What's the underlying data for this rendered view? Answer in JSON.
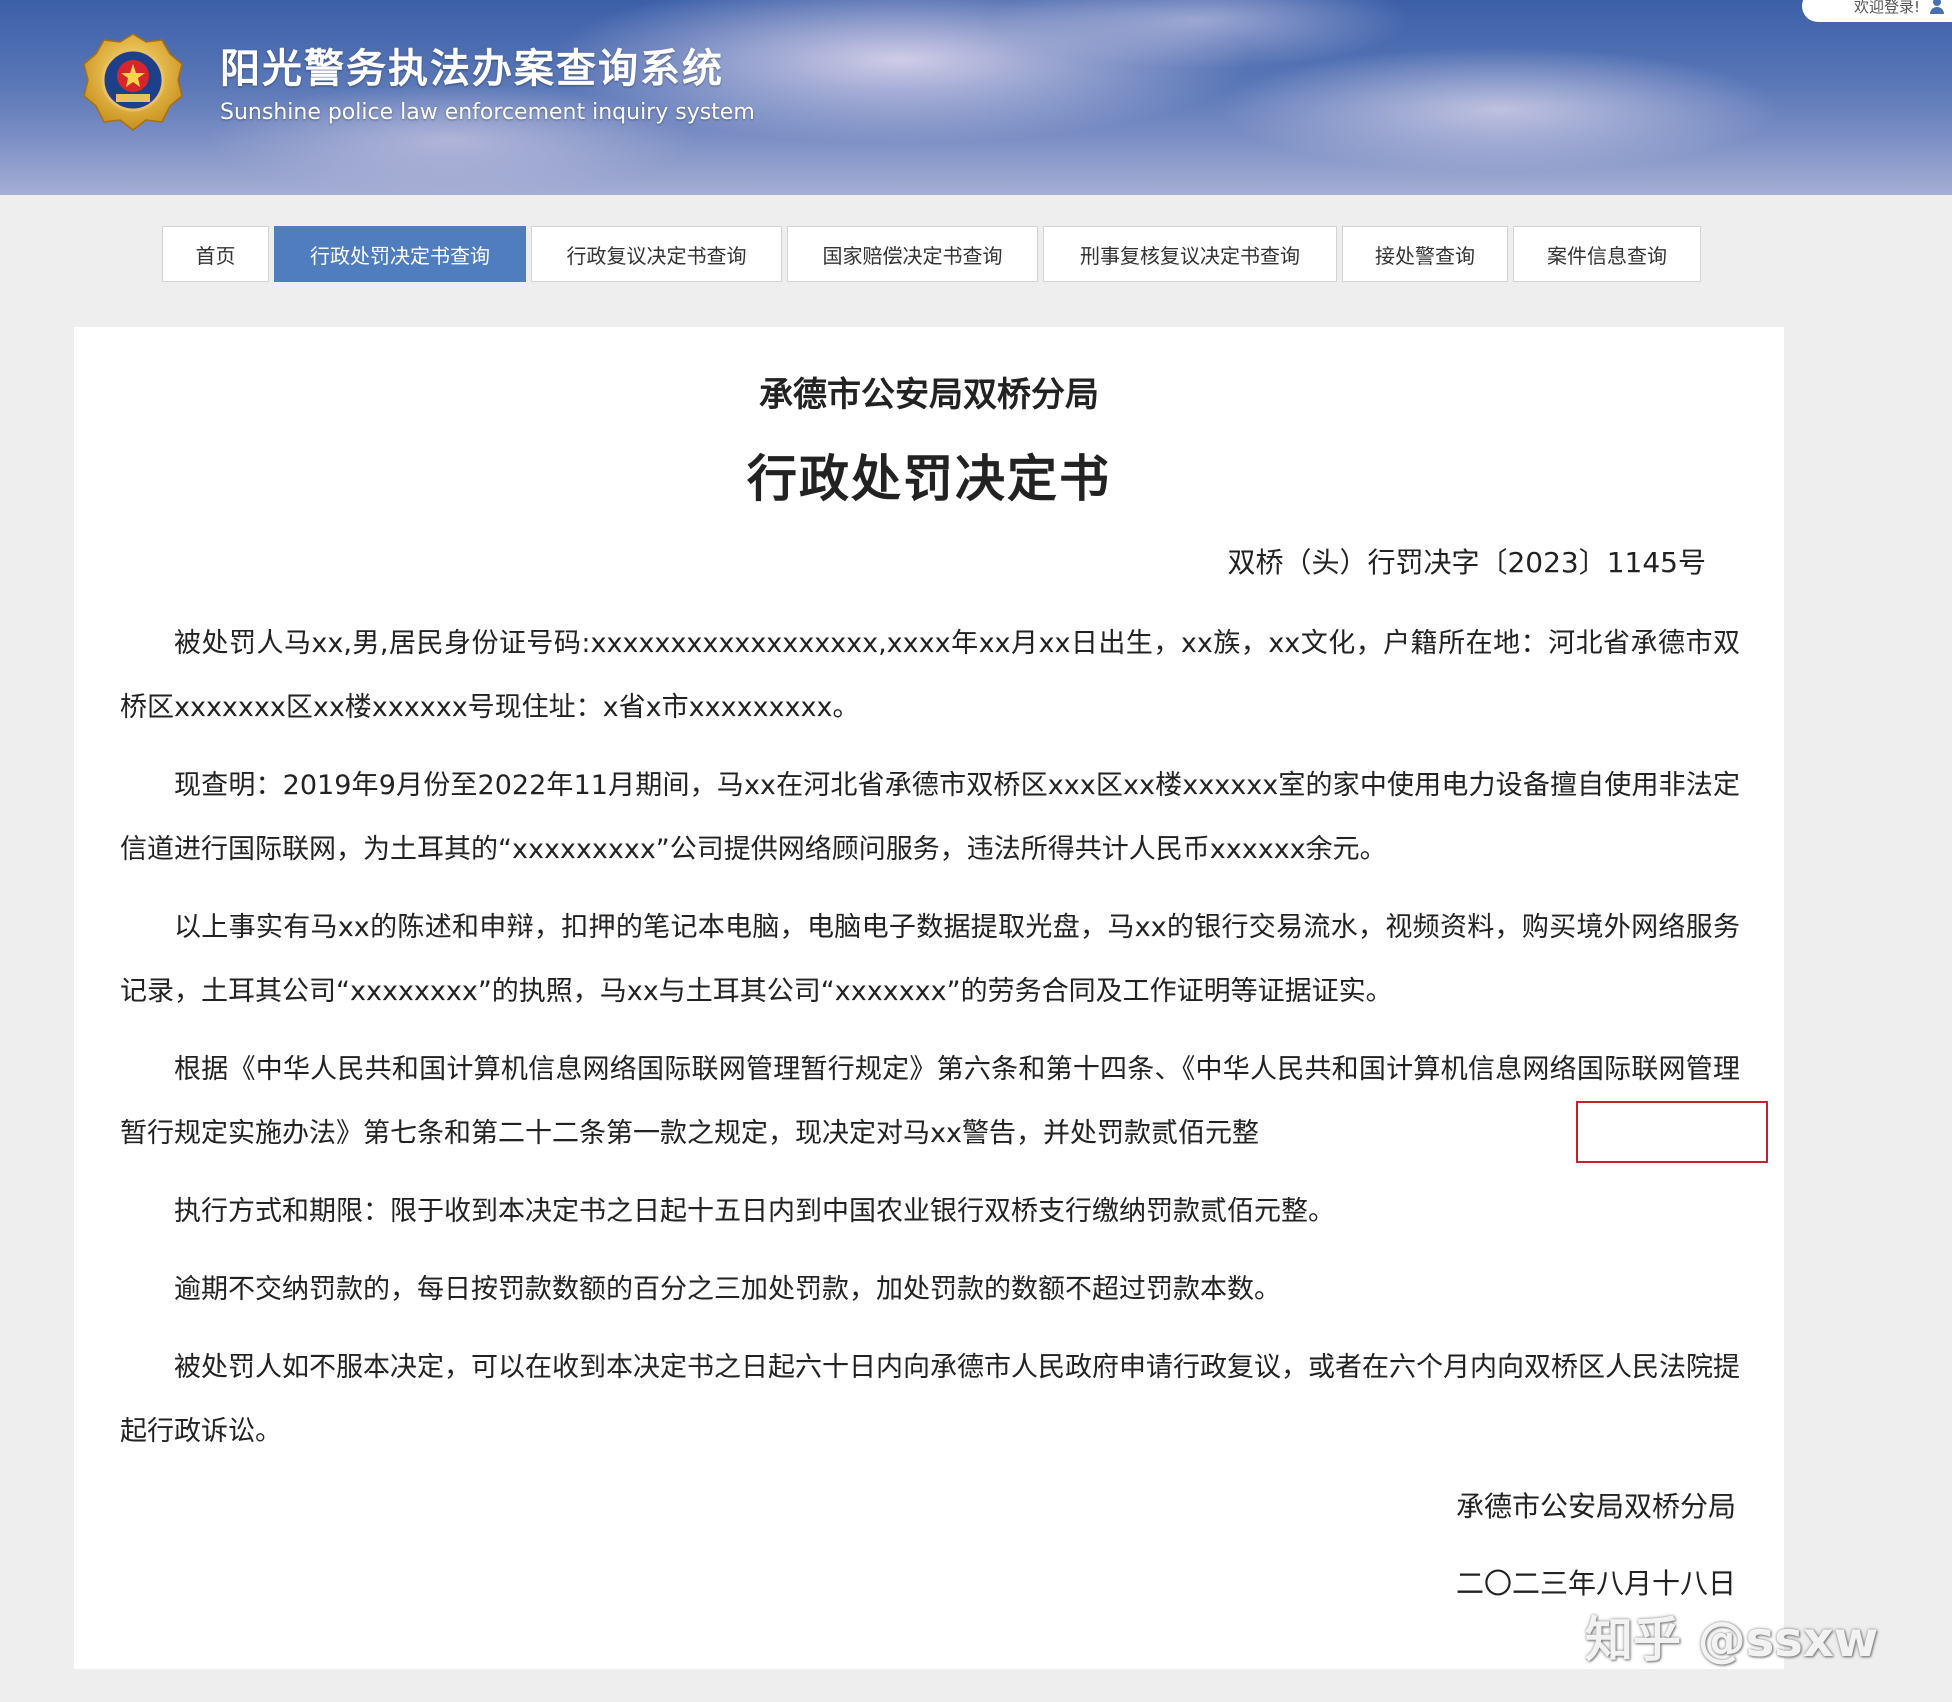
{
  "header": {
    "title": "阳光警务执法办案查询系统",
    "subtitle": "Sunshine police law enforcement inquiry system",
    "login_text": "欢迎登录!",
    "emblem_icon": "police-emblem-icon",
    "user_icon": "user-icon"
  },
  "nav": {
    "tabs": [
      {
        "label": "首页"
      },
      {
        "label": "行政处罚决定书查询"
      },
      {
        "label": "行政复议决定书查询"
      },
      {
        "label": "国家赔偿决定书查询"
      },
      {
        "label": "刑事复核复议决定书查询"
      },
      {
        "label": "接处警查询"
      },
      {
        "label": "案件信息查询"
      }
    ],
    "active_index": 1
  },
  "document": {
    "org": "承德市公安局双桥分局",
    "title": "行政处罚决定书",
    "number": "双桥（头）行罚决字〔2023〕1145号",
    "paragraphs": [
      "被处罚人马xx,男,居民身份证号码:xxxxxxxxxxxxxxxxxx,xxxx年xx月xx日出生，xx族，xx文化，户籍所在地：河北省承德市双桥区xxxxxxx区xx楼xxxxxx号现住址：x省x市xxxxxxxxx。",
      "现查明：2019年9月份至2022年11月期间，马xx在河北省承德市双桥区xxx区xx楼xxxxxx室的家中使用电力设备擅自使用非法定信道进行国际联网，为土耳其的“xxxxxxxxx”公司提供网络顾问服务，违法所得共计人民币xxxxxx余元。",
      "以上事实有马xx的陈述和申辩，扣押的笔记本电脑，电脑电子数据提取光盘，马xx的银行交易流水，视频资料，购买境外网络服务记录，土耳其公司“xxxxxxxx”的执照，马xx与土耳其公司“xxxxxxx”的劳务合同及工作证明等证据证实。",
      "根据《中华人民共和国计算机信息网络国际联网管理暂行规定》第六条和第十四条、《中华人民共和国计算机信息网络国际联网管理暂行规定实施办法》第七条和第二十二条第一款之规定，现决定对马xx警告，并处罚款贰佰元整",
      "执行方式和期限：限于收到本决定书之日起十五日内到中国农业银行双桥支行缴纳罚款贰佰元整。",
      "逾期不交纳罚款的，每日按罚款数额的百分之三加处罚款，加处罚款的数额不超过罚款本数。",
      "被处罚人如不服本决定，可以在收到本决定书之日起六十日内向承德市人民政府申请行政复议，或者在六个月内向双桥区人民法院提起行政诉讼。"
    ],
    "sign_org": "承德市公安局双桥分局",
    "sign_date": "二〇二三年八月十八日"
  },
  "watermark": "知乎 @ssxw",
  "colors": {
    "accent": "#4f7dbd",
    "highlight_box": "#c8202a"
  }
}
